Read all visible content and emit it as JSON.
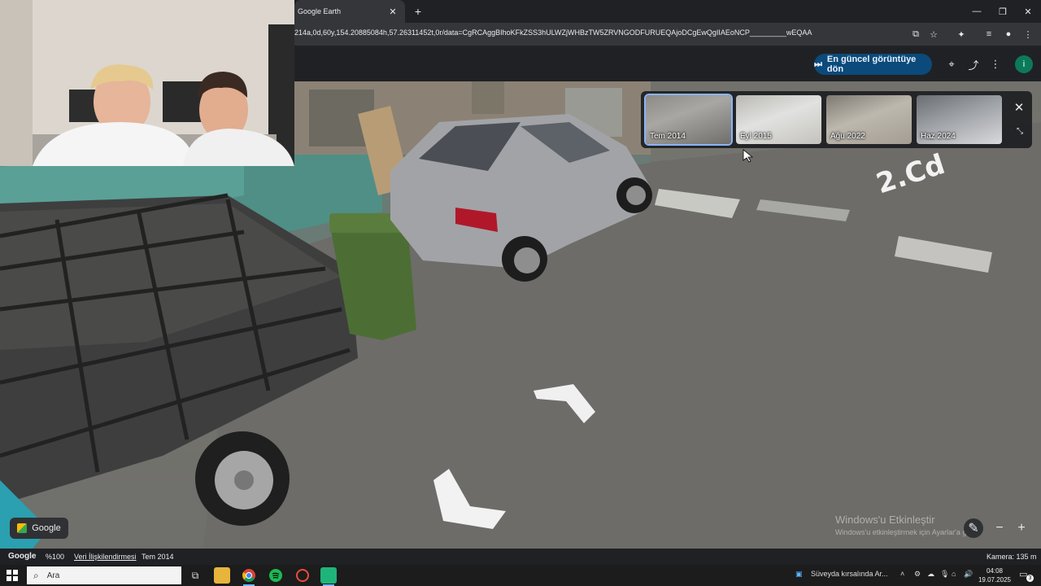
{
  "browser": {
    "tab_title": "Google Earth",
    "url": "214a,0d,60y,154.20885084h,57.26311452t,0r/data=CgRCAggBIhoKFkZSS3hULWZjWHBzTW5ZRVNGODFURUEQAjoDCgEwQgIIAEoNCP_________wEQAA"
  },
  "earth": {
    "latest_button": "En güncel görüntüye dön",
    "avatar_letter": "i",
    "google_chip": "Google",
    "history": [
      {
        "label": "Tem 2014",
        "selected": true
      },
      {
        "label": "Eyl 2015",
        "selected": false
      },
      {
        "label": "Ağu 2022",
        "selected": false
      },
      {
        "label": "Haz 2024",
        "selected": false
      }
    ],
    "road_marking": "2.Cd"
  },
  "status": {
    "brand": "Google",
    "zoom": "%100",
    "data_attribution": "Veri İlişkilendirmesi",
    "date": "Tem 2014",
    "camera": "Kamera: 135 m"
  },
  "watermark": {
    "line1": "Windows'u Etkinleştir",
    "line2": "Windows'u etkinleştirmek için Ayarlar'a gidin."
  },
  "taskbar": {
    "search_placeholder": "Ara",
    "notification": "Süveyda kırsalında Ar...",
    "time": "04:08",
    "date": "19.07.2025",
    "notif_count": "3"
  }
}
